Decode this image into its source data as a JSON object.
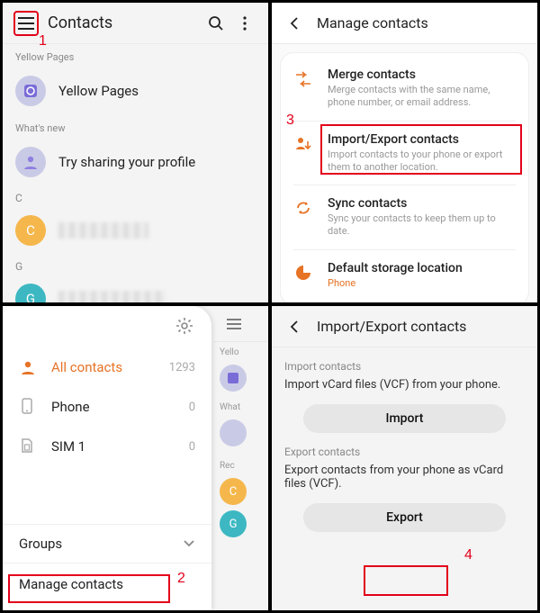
{
  "colors": {
    "accent": "#e67326",
    "annotation": "#e2001a"
  },
  "panel1": {
    "title": "Contacts",
    "sections": {
      "yellowpages_header": "Yellow Pages",
      "yellowpages_row": "Yellow Pages",
      "whatsnew_header": "What's new",
      "profile_row": "Try sharing your profile",
      "letter_c": "C",
      "letter_g": "G",
      "avatar_c": "C",
      "avatar_g": "G"
    }
  },
  "panel2": {
    "title": "Manage contacts",
    "items": [
      {
        "title": "Merge contacts",
        "desc": "Merge contacts with the same name, phone number, or email address."
      },
      {
        "title": "Import/Export contacts",
        "desc": "Import contacts to your phone or export them to another location."
      },
      {
        "title": "Sync contacts",
        "desc": "Sync your contacts to keep them up to date."
      },
      {
        "title": "Default storage location",
        "desc": "Phone"
      }
    ]
  },
  "panel3": {
    "items": [
      {
        "label": "All contacts",
        "count": "1293"
      },
      {
        "label": "Phone",
        "count": "0"
      },
      {
        "label": "SIM 1",
        "count": "0"
      }
    ],
    "groups_label": "Groups",
    "manage_label": "Manage contacts",
    "under": {
      "yellow": "Yello",
      "what": "What",
      "rec": "Rec",
      "av_c": "C",
      "av_g": "G"
    }
  },
  "panel4": {
    "title": "Import/Export contacts",
    "import_header": "Import contacts",
    "import_text": "Import vCard files (VCF) from your phone.",
    "import_btn": "Import",
    "export_header": "Export contacts",
    "export_text": "Export contacts from your phone as vCard files (VCF).",
    "export_btn": "Export"
  },
  "annotations": {
    "n1": "1",
    "n2": "2",
    "n3": "3",
    "n4": "4"
  }
}
